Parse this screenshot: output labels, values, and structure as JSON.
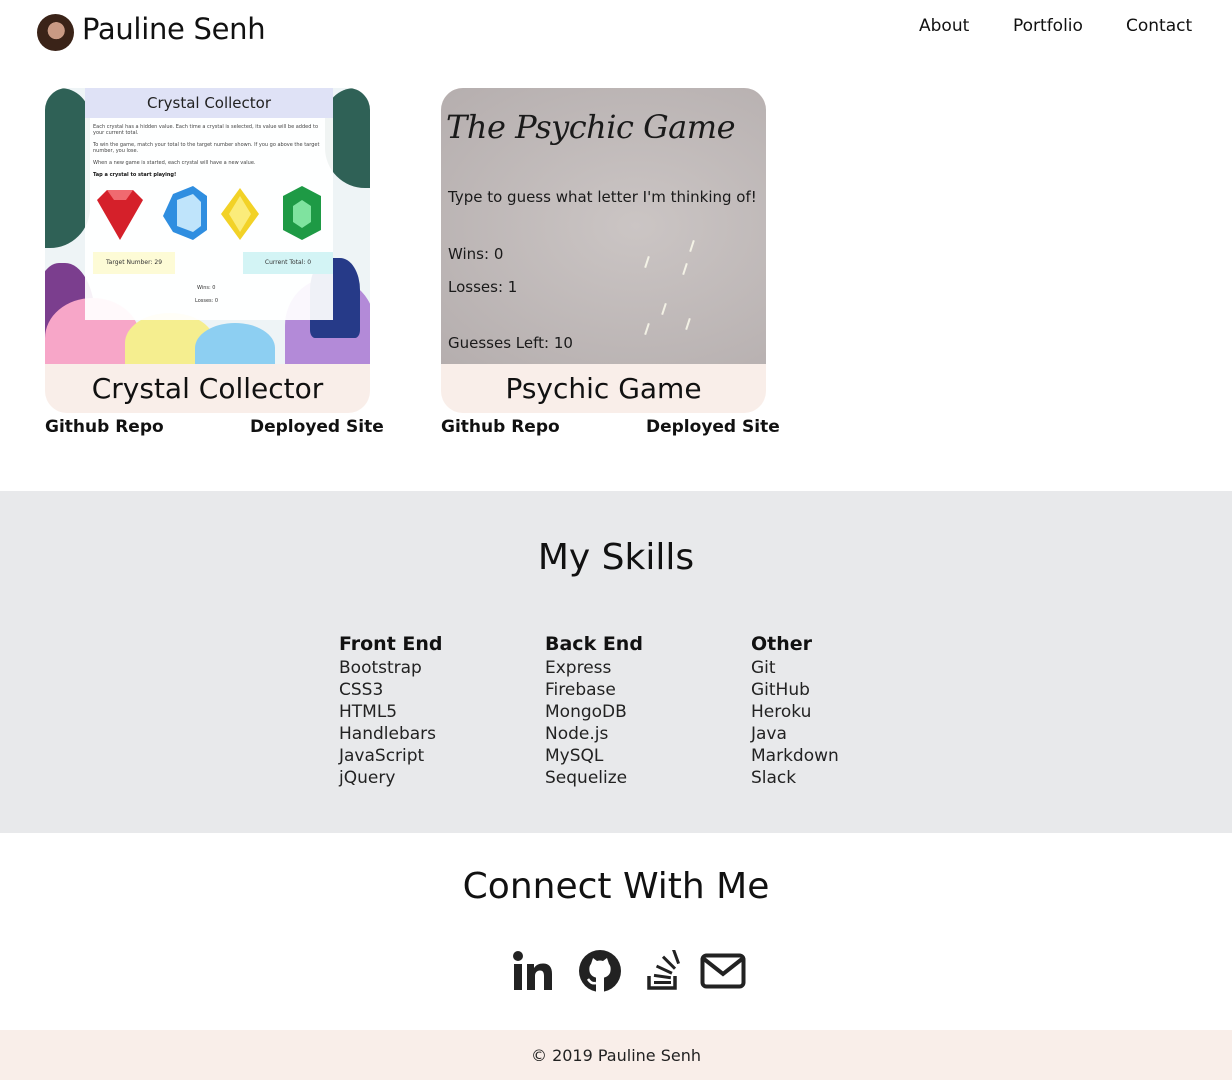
{
  "header": {
    "brand": "Pauline Senh",
    "nav": {
      "about": "About",
      "portfolio": "Portfolio",
      "contact": "Contact"
    }
  },
  "projects": [
    {
      "title": "Crystal Collector",
      "github_label": "Github Repo",
      "deployed_label": "Deployed Site",
      "screenshot": {
        "heading": "Crystal Collector",
        "text1": "Each crystal has a hidden value. Each time a crystal is selected, its value will be added to your current total.",
        "text2": "To win the game, match your total to the target number shown. If you go above the target number, you lose.",
        "text3": "When a new game is started, each crystal will have a new value.",
        "text4": "Tap a crystal to start playing!",
        "target": "Target Number: 29",
        "current": "Current Total: 0",
        "wins": "Wins: 0",
        "losses": "Losses: 0"
      }
    },
    {
      "title": "Psychic Game",
      "github_label": "Github Repo",
      "deployed_label": "Deployed Site",
      "screenshot": {
        "heading": "The Psychic Game",
        "prompt": "Type to guess what letter I'm thinking of!",
        "wins": "Wins: 0",
        "losses": "Losses: 1",
        "guesses_left": "Guesses Left: 10"
      }
    }
  ],
  "skills": {
    "title": "My Skills",
    "columns": [
      {
        "heading": "Front End",
        "items": [
          "Bootstrap",
          "CSS3",
          "HTML5",
          "Handlebars",
          "JavaScript",
          "jQuery"
        ]
      },
      {
        "heading": "Back End",
        "items": [
          "Express",
          "Firebase",
          "MongoDB",
          "Node.js",
          "MySQL",
          "Sequelize"
        ]
      },
      {
        "heading": "Other",
        "items": [
          "Git",
          "GitHub",
          "Heroku",
          "Java",
          "Markdown",
          "Slack"
        ]
      }
    ]
  },
  "connect": {
    "title": "Connect With Me",
    "icons": [
      "linkedin-icon",
      "github-icon",
      "stackoverflow-icon",
      "envelope-icon"
    ]
  },
  "footer": {
    "copyright": "© 2019 Pauline Senh"
  },
  "colors": {
    "accent": "#f9eee9",
    "skills_bg": "#e8e9eb",
    "text": "#111111"
  }
}
